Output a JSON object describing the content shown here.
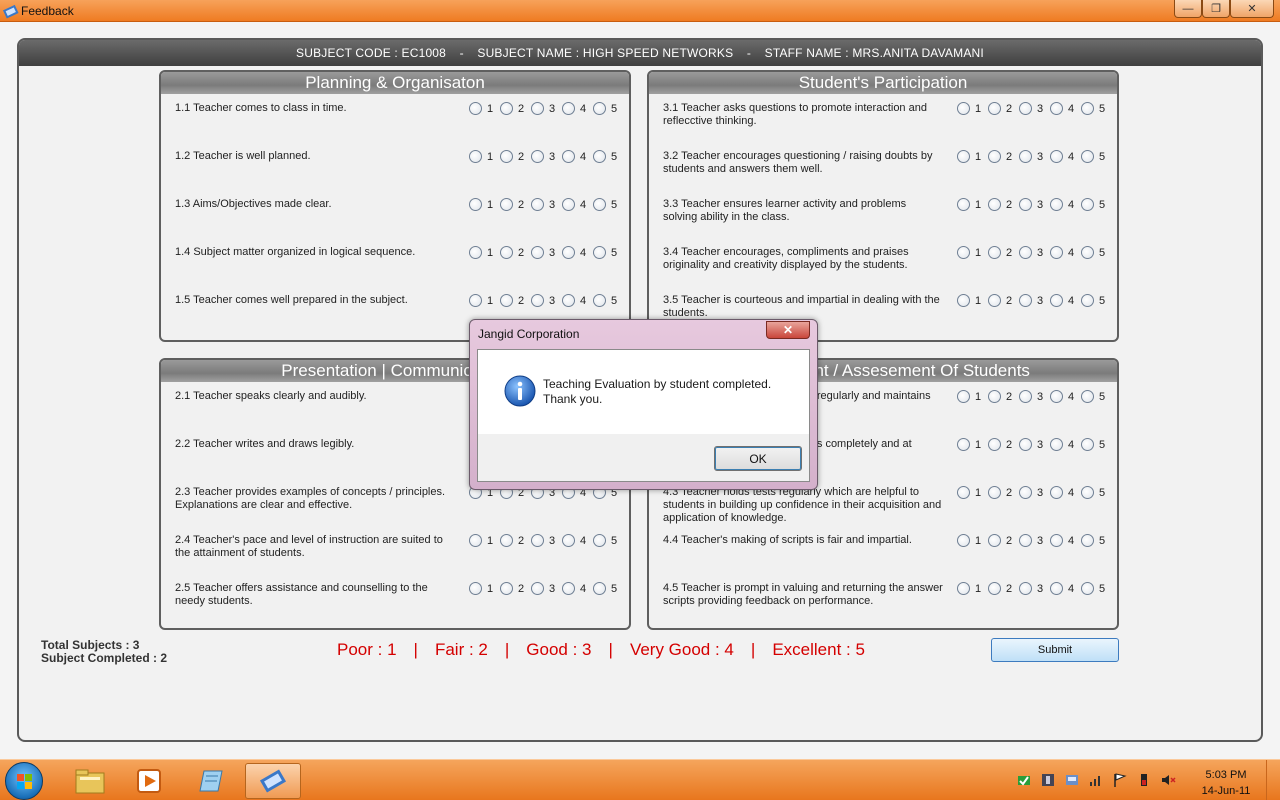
{
  "window": {
    "title": "Feedback",
    "min_glyph": "—",
    "max_glyph": "❐",
    "close_glyph": "✕"
  },
  "header": {
    "subject_code": "SUBJECT CODE :  EC1008",
    "subject_name": "SUBJECT NAME :  HIGH SPEED NETWORKS",
    "staff_name": "STAFF NAME :  MRS.ANITA DAVAMANI",
    "separator": "-"
  },
  "options": [
    "1",
    "2",
    "3",
    "4",
    "5"
  ],
  "panels": [
    {
      "title": "Planning & Organisaton",
      "questions": [
        "1.1 Teacher comes to class in time.",
        "1.2 Teacher is well planned.",
        "1.3 Aims/Objectives made clear.",
        "1.4 Subject matter organized in logical sequence.",
        "1.5 Teacher comes well prepared in the subject."
      ]
    },
    {
      "title": "Student's Participation",
      "questions": [
        "3.1 Teacher asks questions to promote interaction and reflecctive thinking.",
        "3.2 Teacher encourages questioning / raising doubts by students and answers them well.",
        "3.3 Teacher ensures learner activity and problems solving ability in the class.",
        "3.4 Teacher encourages, compliments and praises originality and creativity displayed by the students.",
        "3.5 Teacher is courteous and impartial in dealing with the students."
      ]
    },
    {
      "title": "Presentation | Communication",
      "questions": [
        "2.1 Teacher speaks clearly and audibly.",
        "2.2 Teacher writes and draws legibly.",
        "2.3 Teacher provides examples of concepts / principles. Explanations are clear and effective.",
        "2.4 Teacher's pace and level of instruction are suited to the attainment of students.",
        "2.5 Teacher offers assistance and counselling to the needy students."
      ]
    },
    {
      "title": "Assessment / Assesement Of Students",
      "questions": [
        "4.1 Teacher gives assignments regularly and maintains",
        "4.2 Teacher checks assignments completely and at",
        "4.3 Teacher holds tests regularly which are helpful to students in building up confidence in their acquisition and application of knowledge.",
        "4.4 Teacher's making of scripts is fair and impartial.",
        "4.5 Teacher is prompt in valuing and returning the answer scripts providing feedback on performance."
      ]
    }
  ],
  "totals": {
    "total_subjects": "Total Subjects : 3",
    "subject_completed": "Subject Completed : 2"
  },
  "legend": [
    "Poor : 1",
    "Fair : 2",
    "Good : 3",
    "Very Good : 4",
    "Excellent : 5"
  ],
  "legend_separator": "|",
  "submit_label": "Submit",
  "dialog": {
    "title": "Jangid Corporation",
    "close_glyph": "✕",
    "message_line1": "Teaching Evaluation by student completed.",
    "message_line2": "Thank you.",
    "ok_label": "OK"
  },
  "taskbar": {
    "time": "5:03 PM",
    "date": "14-Jun-11"
  },
  "colors": {
    "legend_red": "#d40000",
    "taskbar_orange": "#ef7b22",
    "header_dark": "#4a4a4a"
  }
}
